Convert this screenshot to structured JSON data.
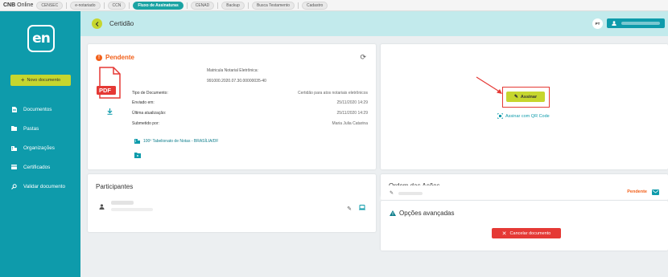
{
  "topbar": {
    "brand_strong": "CNB",
    "brand_rest": "Online",
    "items": [
      {
        "label": "CENSEC",
        "active": false
      },
      {
        "label": "e-notariado",
        "active": false
      },
      {
        "label": "CCN",
        "active": false
      },
      {
        "label": "Fluxo de Assinaturas",
        "active": true
      },
      {
        "label": "CENAD",
        "active": false
      },
      {
        "label": "Backup",
        "active": false
      },
      {
        "label": "Busca Testamento",
        "active": false
      },
      {
        "label": "Cadastro",
        "active": false
      }
    ]
  },
  "sidebar": {
    "logo_text": "en",
    "new_document_label": "Novo documento",
    "items": [
      {
        "label": "Documentos",
        "icon": "file-icon"
      },
      {
        "label": "Pastas",
        "icon": "folder-icon"
      },
      {
        "label": "Organizações",
        "icon": "building-icon"
      },
      {
        "label": "Certificados",
        "icon": "card-icon"
      },
      {
        "label": "Validar documento",
        "icon": "search-icon"
      }
    ]
  },
  "header": {
    "title": "Certidão",
    "avatar_initials": "PT"
  },
  "document": {
    "status": "Pendente",
    "matricula_label": "Matricula Notarial Eletrônica:",
    "matricula_value": "991000.2020.07.30.00000035-40",
    "pdf_label": "PDF",
    "fields": [
      {
        "label": "Tipo de Documento:",
        "value": "Certidão para atos notariais eletrônicos"
      },
      {
        "label": "Enviado em:",
        "value": "25/11/2020 14:29"
      },
      {
        "label": "Última atualização:",
        "value": "25/11/2020 14:29"
      },
      {
        "label": "Submetido por:",
        "value": "Maria Julia Catarina"
      }
    ],
    "office": "100º Tabelionato de Notas - BRASÍLIA/DF"
  },
  "sign": {
    "sign_label": "Assinar",
    "qr_label": "Assinar com QR Code"
  },
  "participants": {
    "title": "Participantes"
  },
  "actions_order": {
    "title": "Ordem das Ações",
    "status": "Pendente"
  },
  "advanced": {
    "title": "Opções avançadas",
    "cancel_label": "Cancelar documento"
  },
  "colors": {
    "teal": "#0e9bab",
    "lime": "#c6d62e",
    "orange": "#f2601a",
    "red": "#e53935",
    "header_bg": "#c2eaec"
  }
}
